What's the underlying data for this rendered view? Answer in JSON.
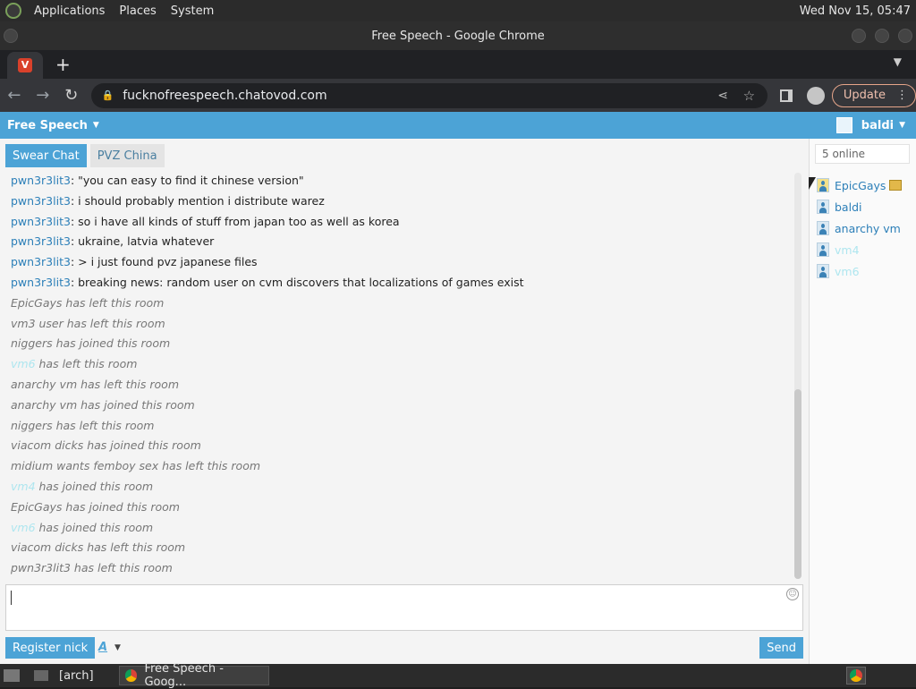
{
  "desktop": {
    "menus": [
      "Applications",
      "Places",
      "System"
    ],
    "clock": "Wed Nov 15, 05:47"
  },
  "window": {
    "title": "Free Speech - Google Chrome"
  },
  "browser": {
    "url": "fucknofreespeech.chatovod.com",
    "update_label": "Update",
    "favicon_letter": "V"
  },
  "chat": {
    "room_name": "Free Speech",
    "username": "baldi",
    "tabs": [
      "Swear Chat",
      "PVZ China"
    ],
    "messages": [
      {
        "type": "msg",
        "nick": "pwn3r3lit3",
        "text": ": \"you can easy to find it chinese version\""
      },
      {
        "type": "msg",
        "nick": "pwn3r3lit3",
        "text": ": i should probably mention i distribute warez"
      },
      {
        "type": "msg",
        "nick": "pwn3r3lit3",
        "text": ": so i have all kinds of stuff from japan too as well as korea"
      },
      {
        "type": "msg",
        "nick": "pwn3r3lit3",
        "text": ": ukraine, latvia whatever"
      },
      {
        "type": "msg",
        "nick": "pwn3r3lit3",
        "text": ": > i just found pvz japanese files"
      },
      {
        "type": "msg",
        "nick": "pwn3r3lit3",
        "text": ": breaking news: random user on cvm discovers that localizations of games exist"
      },
      {
        "type": "sys",
        "text": "EpicGays has left this room"
      },
      {
        "type": "sys",
        "text": "vm3 user has left this room"
      },
      {
        "type": "sys",
        "text": "niggers has joined this room"
      },
      {
        "type": "sysnick",
        "nick": "vm6",
        "text": " has left this room"
      },
      {
        "type": "sys",
        "text": "anarchy vm has left this room"
      },
      {
        "type": "sys",
        "text": "anarchy vm has joined this room"
      },
      {
        "type": "sys",
        "text": "niggers has left this room"
      },
      {
        "type": "sys",
        "text": "viacom dicks has joined this room"
      },
      {
        "type": "sys",
        "text": "midium wants femboy sex has left this room"
      },
      {
        "type": "sysnick",
        "nick": "vm4",
        "text": " has joined this room"
      },
      {
        "type": "sys",
        "text": "EpicGays has joined this room"
      },
      {
        "type": "sysnick",
        "nick": "vm6",
        "text": " has joined this room"
      },
      {
        "type": "sys",
        "text": "viacom dicks has left this room"
      },
      {
        "type": "sys",
        "text": "pwn3r3lit3 has left this room"
      }
    ],
    "register_label": "Register nick",
    "font_label": "A",
    "send_label": "Send",
    "online_label": "5 online",
    "users": [
      {
        "name": "EpicGays",
        "admin": true,
        "faint": false
      },
      {
        "name": "baldi",
        "admin": false,
        "faint": false
      },
      {
        "name": "anarchy vm",
        "admin": false,
        "faint": false
      },
      {
        "name": "vm4",
        "admin": false,
        "faint": true
      },
      {
        "name": "vm6",
        "admin": false,
        "faint": true
      }
    ]
  },
  "taskbar": {
    "items": [
      "[arch]",
      "Free Speech - Goog..."
    ]
  },
  "colors": {
    "accent": "#4ca3d6",
    "nick": "#2c7fb8"
  }
}
